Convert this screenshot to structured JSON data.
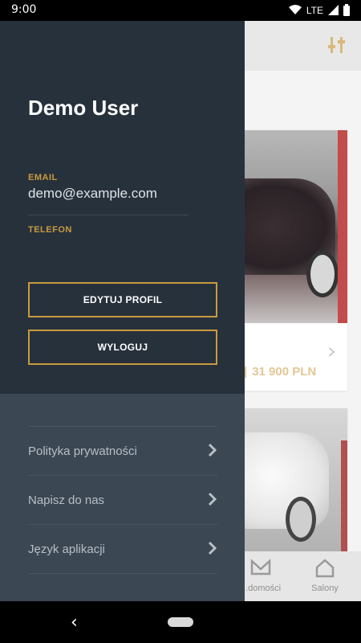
{
  "status_bar": {
    "time": "9:00",
    "network": "LTE",
    "icons": [
      "wifi-icon",
      "signal-icon",
      "battery-icon"
    ]
  },
  "drawer": {
    "user_name": "Demo User",
    "email_label": "EMAIL",
    "email_value": "demo@example.com",
    "phone_label": "TELEFON",
    "phone_value": "",
    "edit_profile_label": "EDYTUJ PROFIL",
    "logout_label": "WYLOGUJ",
    "menu_items": [
      {
        "label": "Polityka prywatności",
        "icon": "chevron-right-icon"
      },
      {
        "label": "Napisz do nas",
        "icon": "chevron-right-icon"
      },
      {
        "label": "Język aplikacji",
        "icon": "chevron-right-icon"
      }
    ]
  },
  "background": {
    "top_bar_icon": "filter-sliders-icon",
    "card_1_price": "31 900 PLN",
    "bottom_nav": [
      {
        "label": "...domości",
        "icon": "messages-icon"
      },
      {
        "label": "Salony",
        "icon": "home-icon"
      }
    ]
  },
  "colors": {
    "drawer_top": "#27313c",
    "drawer_bottom": "#3b4753",
    "accent": "#c99a3f"
  }
}
